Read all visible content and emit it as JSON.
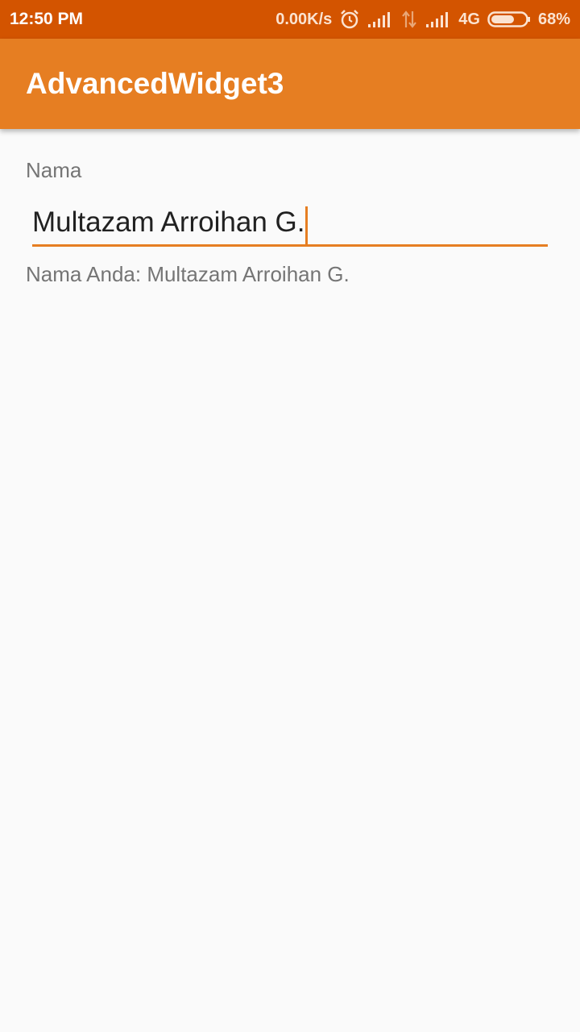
{
  "status_bar": {
    "time": "12:50 PM",
    "net_speed": "0.00K/s",
    "network_type": "4G",
    "battery_percent": "68%",
    "battery_level": 0.68,
    "icons": [
      "alarm-icon",
      "signal-icon",
      "data-arrows-icon",
      "signal-icon",
      "battery-icon"
    ]
  },
  "app_bar": {
    "title": "AdvancedWidget3"
  },
  "form": {
    "name_label": "Nama",
    "name_value": "Multazam Arroihan G.",
    "result_text": "Nama Anda: Multazam Arroihan G."
  },
  "colors": {
    "status_bar": "#d35400",
    "app_bar": "#e67e22",
    "accent": "#e67e22",
    "background": "#fafafa"
  }
}
